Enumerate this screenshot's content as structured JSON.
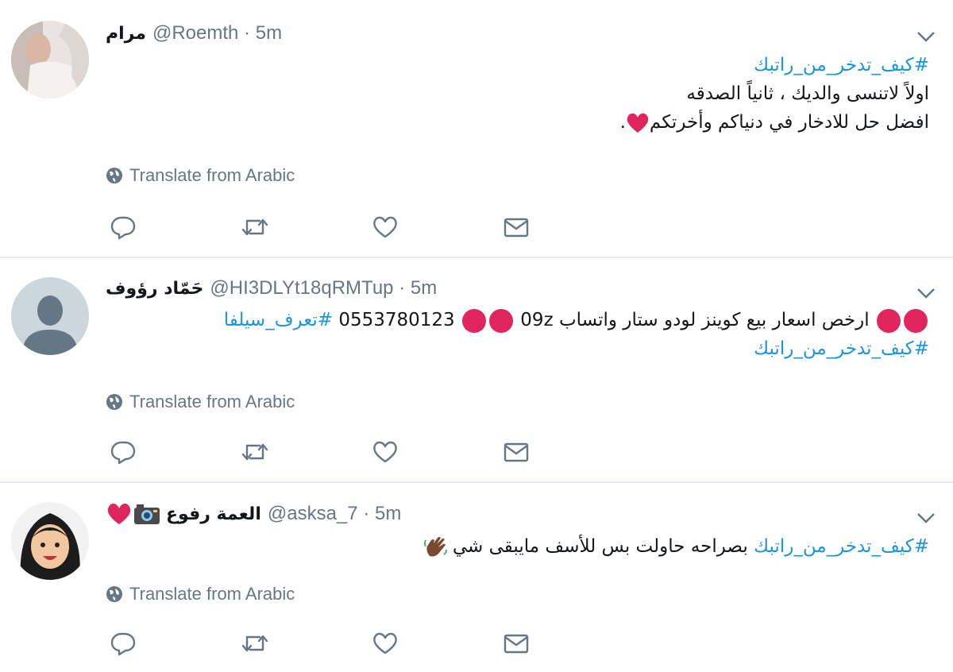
{
  "tweets": [
    {
      "name": "مرام",
      "handle": "@Roemth",
      "time": "· 5m",
      "lines": [
        "#كيف_تدخر_من_راتبك",
        "اولاً لاتنسى والديك ، ثانياً الصدقه",
        "افضل حل للادخار في دنياكم وأخرتكم"
      ],
      "line3_suffix": ".",
      "translate": "Translate from Arabic"
    },
    {
      "name": "حَمّاد رؤوف",
      "handle": "@HI3DLYt18qRMTup",
      "time": "· 5m",
      "text_main": "ارخص اسعار بيع كوينز لودو ستار واتساب",
      "phone": "0553780123",
      "code": "09z",
      "hashtag1": "#تعرف_سيلفا",
      "hashtag2": "#كيف_تدخر_من_راتبك",
      "translate": "Translate from Arabic"
    },
    {
      "name": "العمة رفوع",
      "handle": "@asksa_7",
      "time": "· 5m",
      "hashtag": "#كيف_تدخر_من_راتبك",
      "text": "بصراحه حاولت بس للأسف مايبقى شي",
      "translate": "Translate from Arabic"
    }
  ],
  "icons": {
    "reply": "reply-icon",
    "retweet": "retweet-icon",
    "like": "heart-icon",
    "dm": "mail-icon",
    "globe": "globe-icon",
    "chevron": "chevron-down-icon"
  },
  "colors": {
    "link": "#1b95e0",
    "muted": "#657786",
    "red": "#e0245e",
    "divider": "#e6ecf0"
  }
}
